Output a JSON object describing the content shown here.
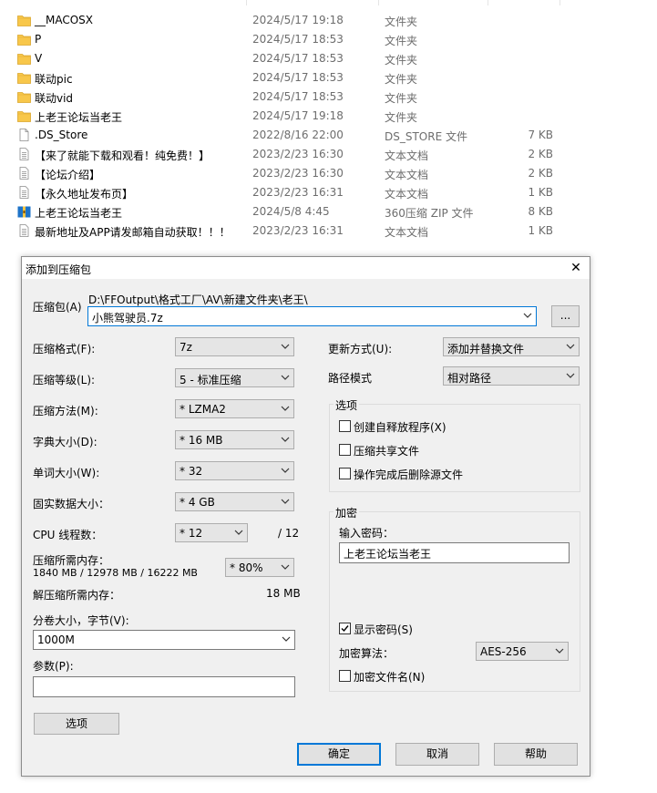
{
  "files": [
    {
      "name": "__MACOSX",
      "date": "2024/5/17 19:18",
      "type": "文件夹",
      "size": "",
      "icon": "folder-icon"
    },
    {
      "name": "P",
      "date": "2024/5/17 18:53",
      "type": "文件夹",
      "size": "",
      "icon": "folder-icon"
    },
    {
      "name": "V",
      "date": "2024/5/17 18:53",
      "type": "文件夹",
      "size": "",
      "icon": "folder-icon"
    },
    {
      "name": "联动pic",
      "date": "2024/5/17 18:53",
      "type": "文件夹",
      "size": "",
      "icon": "folder-icon"
    },
    {
      "name": "联动vid",
      "date": "2024/5/17 18:53",
      "type": "文件夹",
      "size": "",
      "icon": "folder-icon"
    },
    {
      "name": "上老王论坛当老王",
      "date": "2024/5/17 19:18",
      "type": "文件夹",
      "size": "",
      "icon": "folder-icon"
    },
    {
      "name": ".DS_Store",
      "date": "2022/8/16 22:00",
      "type": "DS_STORE 文件",
      "size": "7 KB",
      "icon": "file-icon"
    },
    {
      "name": "【来了就能下载和观看！纯免费！】",
      "date": "2023/2/23 16:30",
      "type": "文本文档",
      "size": "2 KB",
      "icon": "text-file-icon"
    },
    {
      "name": "【论坛介绍】",
      "date": "2023/2/23 16:30",
      "type": "文本文档",
      "size": "2 KB",
      "icon": "text-file-icon"
    },
    {
      "name": "【永久地址发布页】",
      "date": "2023/2/23 16:31",
      "type": "文本文档",
      "size": "1 KB",
      "icon": "text-file-icon"
    },
    {
      "name": "上老王论坛当老王",
      "date": "2024/5/8 4:45",
      "type": "360压缩 ZIP 文件",
      "size": "8 KB",
      "icon": "zip-archive-icon"
    },
    {
      "name": "最新地址及APP请发邮箱自动获取！！！",
      "date": "2023/2/23 16:31",
      "type": "文本文档",
      "size": "1 KB",
      "icon": "text-file-icon"
    }
  ],
  "dialog": {
    "title": "添加到压缩包",
    "close_glyph": "✕",
    "archive": {
      "label": "压缩包(A)",
      "path": "D:\\FFOutput\\格式工厂\\AV\\新建文件夹\\老王\\",
      "value": "小熊驾驶员.7z",
      "browse": "..."
    },
    "left": {
      "format": {
        "label": "压缩格式(F):",
        "value": "7z"
      },
      "level": {
        "label": "压缩等级(L):",
        "value": "5 - 标准压缩"
      },
      "method": {
        "label": "压缩方法(M):",
        "value": "* LZMA2"
      },
      "dict": {
        "label": "字典大小(D):",
        "value": "* 16 MB"
      },
      "word": {
        "label": "单词大小(W):",
        "value": "* 32"
      },
      "solid": {
        "label": "固实数据大小：",
        "value": "* 4 GB"
      },
      "threads": {
        "label": "CPU 线程数：",
        "value": "* 12",
        "total": "/ 12"
      },
      "mem": {
        "label": "压缩所需内存：",
        "detail": "1840 MB / 12978 MB / 16222 MB",
        "value": "* 80%"
      },
      "decomp": {
        "label": "解压缩所需内存：",
        "value": "18 MB"
      },
      "split": {
        "label": "分卷大小，字节(V):",
        "value": "1000M"
      },
      "params": {
        "label": "参数(P):",
        "value": ""
      },
      "options_btn": "选项"
    },
    "right": {
      "update": {
        "label": "更新方式(U):",
        "value": "添加并替换文件"
      },
      "path_mode": {
        "label": "路径模式",
        "value": "相对路径"
      },
      "options": {
        "title": "选项",
        "sfx": {
          "label": "创建自释放程序(X)",
          "checked": false
        },
        "shared": {
          "label": "压缩共享文件",
          "checked": false
        },
        "delete": {
          "label": "操作完成后删除源文件",
          "checked": false
        }
      },
      "encryption": {
        "title": "加密",
        "password_label": "输入密码：",
        "password": "上老王论坛当老王",
        "show_password": {
          "label": "显示密码(S)",
          "checked": true
        },
        "method_label": "加密算法：",
        "method": "AES-256",
        "encrypt_names": {
          "label": "加密文件名(N)",
          "checked": false
        }
      }
    },
    "buttons": {
      "ok": "确定",
      "cancel": "取消",
      "help": "帮助"
    }
  },
  "colors": {
    "folder": "#f8c74a",
    "focus": "#0078d7",
    "dialog_bg": "#f0f0f0",
    "zip": "#1e73c8"
  }
}
